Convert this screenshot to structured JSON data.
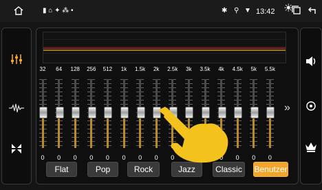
{
  "statusbar": {
    "time": "13:42",
    "icons": [
      "home-icon",
      "notification-icons",
      "bluetooth-icon",
      "location-icon",
      "wifi-icon",
      "brightness-icon",
      "recent-apps-icon",
      "back-icon"
    ]
  },
  "left_menu": [
    "equalizer-icon",
    "waveform-icon",
    "surround-icon"
  ],
  "right_menu": [
    "volume-icon",
    "speaker-icon",
    "crown-icon"
  ],
  "eq": {
    "bands": [
      {
        "freq": "32",
        "value": "0"
      },
      {
        "freq": "64",
        "value": "0"
      },
      {
        "freq": "128",
        "value": "0"
      },
      {
        "freq": "256",
        "value": "0"
      },
      {
        "freq": "512",
        "value": "0"
      },
      {
        "freq": "1k",
        "value": "0"
      },
      {
        "freq": "1.5k",
        "value": "0"
      },
      {
        "freq": "2k",
        "value": "0"
      },
      {
        "freq": "2.5k",
        "value": "0"
      },
      {
        "freq": "3k",
        "value": "0"
      },
      {
        "freq": "3.5k",
        "value": "0"
      },
      {
        "freq": "4k",
        "value": "0"
      },
      {
        "freq": "4.5k",
        "value": "0"
      },
      {
        "freq": "5k",
        "value": "0"
      },
      {
        "freq": "5.5k",
        "value": "0"
      }
    ],
    "next_symbol": "»"
  },
  "presets": [
    "Flat",
    "Pop",
    "Rock",
    "Jazz",
    "Classic",
    "Benutzer"
  ],
  "active_preset": "Benutzer",
  "colors": {
    "accent": "#f1a52a",
    "graph_red": "#e02828",
    "graph_yellow": "#e3b62a",
    "slider_fill": "#b88a2a"
  }
}
